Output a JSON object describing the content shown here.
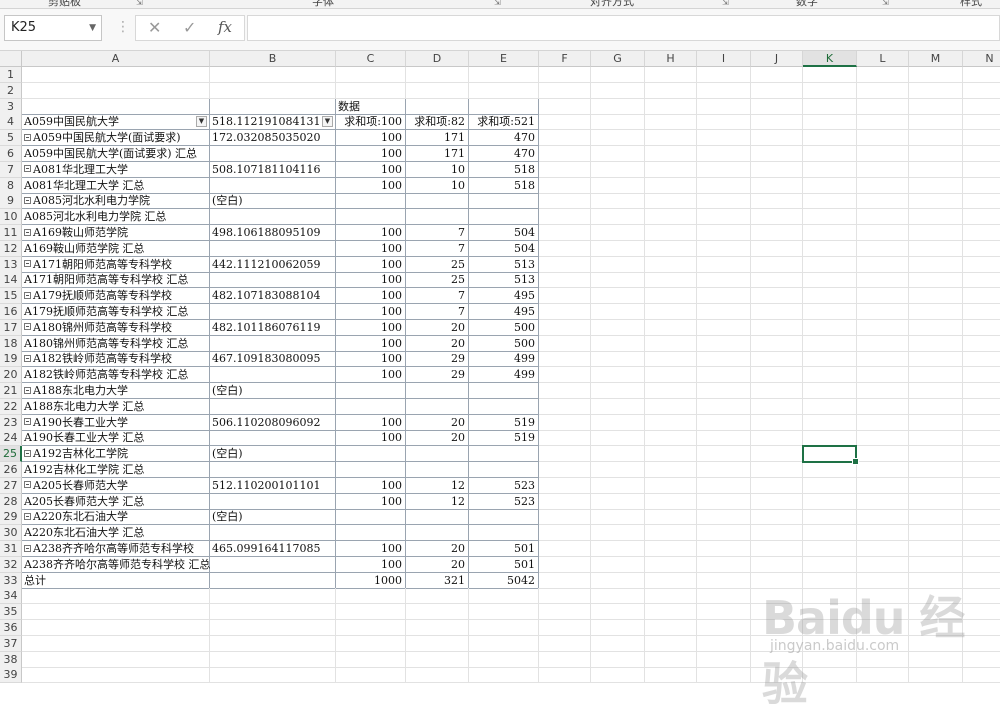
{
  "ribbon": {
    "groups": [
      "剪贴板",
      "字体",
      "对齐方式",
      "数字",
      "样式"
    ]
  },
  "formula_bar": {
    "name_box": "K25",
    "cancel_icon": "✕",
    "enter_icon": "✓",
    "fx_label": "fx",
    "formula": ""
  },
  "columns": [
    "A",
    "B",
    "C",
    "D",
    "E",
    "F",
    "G",
    "H",
    "I",
    "J",
    "K",
    "L",
    "M",
    "N"
  ],
  "selected": {
    "column": "K",
    "row": 25
  },
  "rows": [
    {
      "n": "1",
      "a": "",
      "b": "",
      "c": "",
      "d": "",
      "e": ""
    },
    {
      "n": "2",
      "a": "",
      "b": "",
      "c": "",
      "d": "",
      "e": ""
    },
    {
      "n": "3",
      "a": "",
      "b": "",
      "c": "数据",
      "d": "",
      "e": ""
    },
    {
      "n": "4",
      "a": "A059中国民航大学",
      "b": "518.112191084131",
      "c": "求和项:100",
      "d": "求和项:82",
      "e": "求和项:521"
    },
    {
      "n": "5",
      "a": "A059中国民航大学(面试要求)",
      "b": "172.032085035020",
      "c": "100",
      "d": "171",
      "e": "470"
    },
    {
      "n": "6",
      "a": "A059中国民航大学(面试要求) 汇总",
      "b": "",
      "c": "100",
      "d": "171",
      "e": "470"
    },
    {
      "n": "7",
      "a": "A081华北理工大学",
      "b": "508.107181104116",
      "c": "100",
      "d": "10",
      "e": "518"
    },
    {
      "n": "8",
      "a": "A081华北理工大学      汇总",
      "b": "",
      "c": "100",
      "d": "10",
      "e": "518"
    },
    {
      "n": "9",
      "a": "A085河北水利电力学院",
      "b": "(空白)",
      "c": "",
      "d": "",
      "e": ""
    },
    {
      "n": "10",
      "a": "A085河北水利电力学院   汇总",
      "b": "",
      "c": "",
      "d": "",
      "e": ""
    },
    {
      "n": "11",
      "a": "A169鞍山师范学院",
      "b": "498.106188095109",
      "c": "100",
      "d": "7",
      "e": "504"
    },
    {
      "n": "12",
      "a": "A169鞍山师范学院      汇总",
      "b": "",
      "c": "100",
      "d": "7",
      "e": "504"
    },
    {
      "n": "13",
      "a": "A171朝阳师范高等专科学校",
      "b": "442.111210062059",
      "c": "100",
      "d": "25",
      "e": "513"
    },
    {
      "n": "14",
      "a": "A171朝阳师范高等专科学校 汇总",
      "b": "",
      "c": "100",
      "d": "25",
      "e": "513"
    },
    {
      "n": "15",
      "a": "A179抚顺师范高等专科学校",
      "b": "482.107183088104",
      "c": "100",
      "d": "7",
      "e": "495"
    },
    {
      "n": "16",
      "a": "A179抚顺师范高等专科学校 汇总",
      "b": "",
      "c": "100",
      "d": "7",
      "e": "495"
    },
    {
      "n": "17",
      "a": "A180锦州师范高等专科学校",
      "b": "482.101186076119",
      "c": "100",
      "d": "20",
      "e": "500"
    },
    {
      "n": "18",
      "a": "A180锦州师范高等专科学校 汇总",
      "b": "",
      "c": "100",
      "d": "20",
      "e": "500"
    },
    {
      "n": "19",
      "a": "A182铁岭师范高等专科学校",
      "b": "467.109183080095",
      "c": "100",
      "d": "29",
      "e": "499"
    },
    {
      "n": "20",
      "a": "A182铁岭师范高等专科学校 汇总",
      "b": "",
      "c": "100",
      "d": "29",
      "e": "499"
    },
    {
      "n": "21",
      "a": "A188东北电力大学",
      "b": "(空白)",
      "c": "",
      "d": "",
      "e": ""
    },
    {
      "n": "22",
      "a": "A188东北电力大学      汇总",
      "b": "",
      "c": "",
      "d": "",
      "e": ""
    },
    {
      "n": "23",
      "a": "A190长春工业大学",
      "b": "506.110208096092",
      "c": "100",
      "d": "20",
      "e": "519"
    },
    {
      "n": "24",
      "a": "A190长春工业大学      汇总",
      "b": "",
      "c": "100",
      "d": "20",
      "e": "519"
    },
    {
      "n": "25",
      "a": "A192吉林化工学院",
      "b": "(空白)",
      "c": "",
      "d": "",
      "e": ""
    },
    {
      "n": "26",
      "a": "A192吉林化工学院      汇总",
      "b": "",
      "c": "",
      "d": "",
      "e": ""
    },
    {
      "n": "27",
      "a": "A205长春师范大学",
      "b": "512.110200101101",
      "c": "100",
      "d": "12",
      "e": "523"
    },
    {
      "n": "28",
      "a": "A205长春师范大学      汇总",
      "b": "",
      "c": "100",
      "d": "12",
      "e": "523"
    },
    {
      "n": "29",
      "a": "A220东北石油大学",
      "b": "(空白)",
      "c": "",
      "d": "",
      "e": ""
    },
    {
      "n": "30",
      "a": "A220东北石油大学      汇总",
      "b": "",
      "c": "",
      "d": "",
      "e": ""
    },
    {
      "n": "31",
      "a": "A238齐齐哈尔高等师范专科学校",
      "b": "465.099164117085",
      "c": "100",
      "d": "20",
      "e": "501"
    },
    {
      "n": "32",
      "a": "A238齐齐哈尔高等师范专科学校 汇总",
      "b": "",
      "c": "100",
      "d": "20",
      "e": "501"
    },
    {
      "n": "33",
      "a": "总计",
      "b": "",
      "c": "1000",
      "d": "321",
      "e": "5042"
    },
    {
      "n": "34",
      "a": "",
      "b": "",
      "c": "",
      "d": "",
      "e": ""
    },
    {
      "n": "35",
      "a": "",
      "b": "",
      "c": "",
      "d": "",
      "e": ""
    },
    {
      "n": "36",
      "a": "",
      "b": "",
      "c": "",
      "d": "",
      "e": ""
    },
    {
      "n": "37",
      "a": "",
      "b": "",
      "c": "",
      "d": "",
      "e": ""
    },
    {
      "n": "38",
      "a": "",
      "b": "",
      "c": "",
      "d": "",
      "e": ""
    },
    {
      "n": "39",
      "a": "",
      "b": "",
      "c": "",
      "d": "",
      "e": ""
    }
  ],
  "watermark": {
    "brand": "Baidu 经验",
    "url": "jingyan.baidu.com"
  }
}
